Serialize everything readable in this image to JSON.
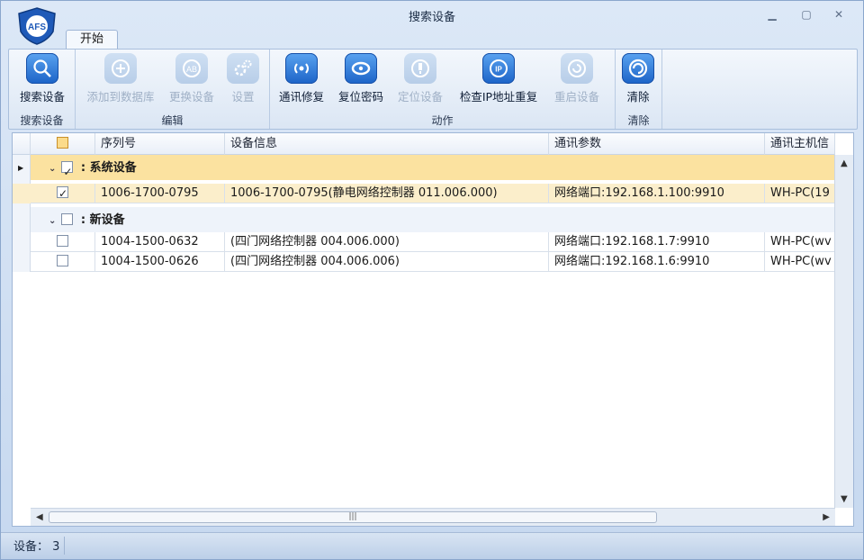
{
  "window": {
    "title": "搜索设备",
    "logo_text": "AFS"
  },
  "tabs": [
    {
      "label": "开始"
    }
  ],
  "ribbon": {
    "groups": [
      {
        "label": "搜索设备",
        "buttons": [
          {
            "label": "搜索设备",
            "icon": "search-icon",
            "enabled": true
          }
        ]
      },
      {
        "label": "编辑",
        "buttons": [
          {
            "label": "添加到数据库",
            "icon": "add-icon",
            "enabled": false
          },
          {
            "label": "更换设备",
            "icon": "swap-icon",
            "enabled": false
          },
          {
            "label": "设置",
            "icon": "gear-icon",
            "enabled": false
          }
        ]
      },
      {
        "label": "动作",
        "buttons": [
          {
            "label": "通讯修复",
            "icon": "signal-icon",
            "enabled": true
          },
          {
            "label": "复位密码",
            "icon": "key-icon",
            "enabled": true
          },
          {
            "label": "定位设备",
            "icon": "locate-icon",
            "enabled": false
          },
          {
            "label": "检查IP地址重复",
            "icon": "ip-icon",
            "enabled": true
          },
          {
            "label": "重启设备",
            "icon": "restart-icon",
            "enabled": false
          }
        ]
      },
      {
        "label": "清除",
        "buttons": [
          {
            "label": "清除",
            "icon": "clear-icon",
            "enabled": true
          }
        ]
      }
    ]
  },
  "grid": {
    "columns": [
      "序列号",
      "设备信息",
      "通讯参数",
      "通讯主机信"
    ],
    "groups": [
      {
        "label": "系统设备",
        "checked": true,
        "rows": [
          {
            "serial": "1006-1700-0795",
            "info": "1006-1700-0795(静电网络控制器 011.006.000)",
            "params": "网络端口:192.168.1.100:9910",
            "host": "WH-PC(19",
            "checked": true
          }
        ]
      },
      {
        "label": "新设备",
        "checked": false,
        "rows": [
          {
            "serial": "1004-1500-0632",
            "info": "(四门网络控制器 004.006.000)",
            "params": "网络端口:192.168.1.7:9910",
            "host": "WH-PC(wv",
            "checked": false
          },
          {
            "serial": "1004-1500-0626",
            "info": "(四门网络控制器 004.006.006)",
            "params": "网络端口:192.168.1.6:9910",
            "host": "WH-PC(wv",
            "checked": false
          }
        ]
      }
    ]
  },
  "status": {
    "label": "设备：",
    "count": "3"
  },
  "colors": {
    "accent": "#1c63c7",
    "selected_row": "#fbeecb",
    "group_highlight": "#fbe2a0"
  }
}
